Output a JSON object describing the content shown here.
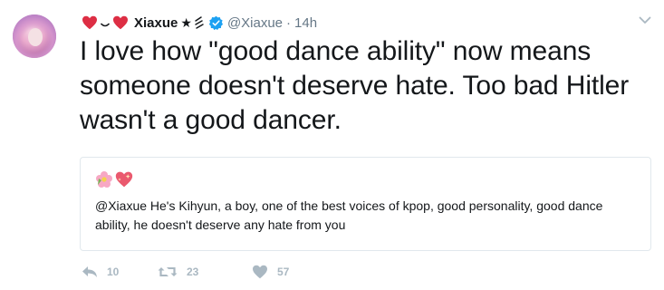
{
  "tweet": {
    "display_name": "Xiaxue",
    "handle": "@Xiaxue",
    "separator": "·",
    "time": "14h",
    "star_glyph": "★",
    "text": "I love how \"good dance ability\" now means someone doesn't deserve hate. Too bad Hitler wasn't a good dancer.",
    "verified": true,
    "icons": [
      "red-heart-icon",
      "smile-icon",
      "red-heart-icon",
      "star-icon",
      "squiggle-icon",
      "verified-icon",
      "chevron-down-icon"
    ]
  },
  "quote": {
    "emojis": [
      "hibiscus-icon",
      "sparkling-heart-icon"
    ],
    "text": "@Xiaxue He's Kihyun, a boy, one of the best voices of kpop, good personality, good dance ability, he doesn't deserve any hate from you"
  },
  "actions": {
    "reply_count": "10",
    "retweet_count": "23",
    "like_count": "57"
  },
  "colors": {
    "text": "#14171a",
    "muted": "#657786",
    "action": "#aab8c2",
    "verified": "#1da1f2",
    "heart": "#e0245e",
    "border": "#e1e8ed"
  }
}
